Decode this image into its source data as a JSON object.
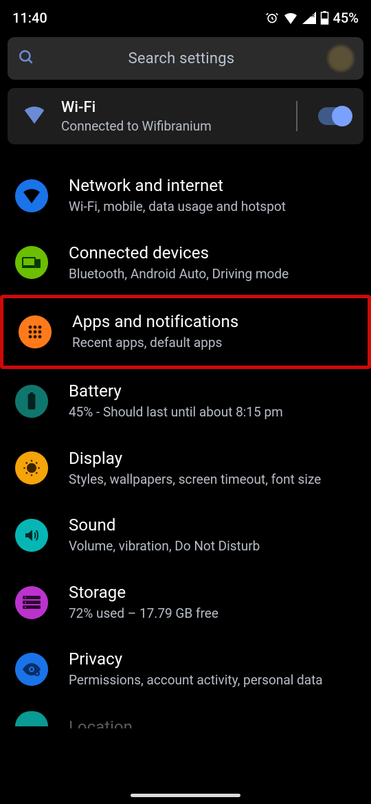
{
  "status": {
    "time": "11:40",
    "battery": "45%"
  },
  "search": {
    "placeholder": "Search settings"
  },
  "wifi": {
    "title": "Wi-Fi",
    "subtitle": "Connected to Wifibranium",
    "on": true
  },
  "items": [
    {
      "title": "Network and internet",
      "subtitle": "Wi-Fi, mobile, data usage and hotspot"
    },
    {
      "title": "Connected devices",
      "subtitle": "Bluetooth, Android Auto, Driving mode"
    },
    {
      "title": "Apps and notifications",
      "subtitle": "Recent apps, default apps"
    },
    {
      "title": "Battery",
      "subtitle": "45% - Should last until about 8:15 pm"
    },
    {
      "title": "Display",
      "subtitle": "Styles, wallpapers, screen timeout, font size"
    },
    {
      "title": "Sound",
      "subtitle": "Volume, vibration, Do Not Disturb"
    },
    {
      "title": "Storage",
      "subtitle": "72% used – 17.79 GB free"
    },
    {
      "title": "Privacy",
      "subtitle": "Permissions, account activity, personal data"
    }
  ],
  "peek": {
    "title": "Location"
  },
  "highlight_index": 2
}
